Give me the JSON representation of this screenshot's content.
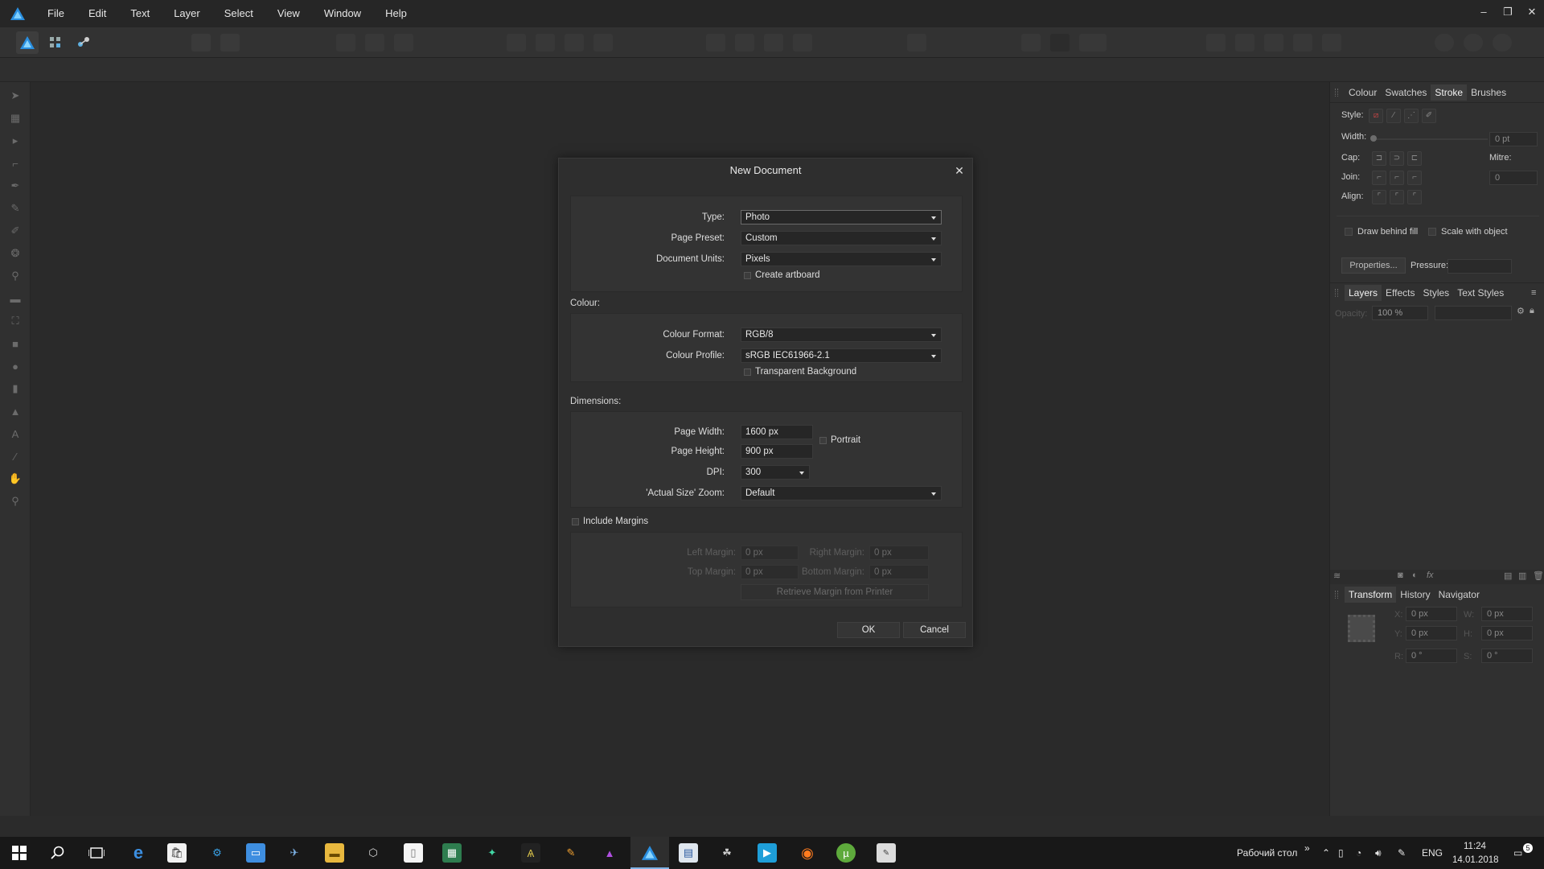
{
  "menu": {
    "items": [
      "File",
      "Edit",
      "Text",
      "Layer",
      "Select",
      "View",
      "Window",
      "Help"
    ]
  },
  "window_controls": {
    "minimize": "–",
    "restore": "❐",
    "close": "✕"
  },
  "right_panel": {
    "top_tabs": [
      "Colour",
      "Swatches",
      "Stroke",
      "Brushes"
    ],
    "top_active": "Stroke",
    "stroke": {
      "style_label": "Style:",
      "width_label": "Width:",
      "width_value": "0 pt",
      "cap_label": "Cap:",
      "mitre_label": "Mitre:",
      "mitre_value": "0",
      "join_label": "Join:",
      "align_label": "Align:",
      "draw_behind_fill": "Draw behind fill",
      "scale_with_object": "Scale with object",
      "properties_button": "Properties...",
      "pressure_label": "Pressure:"
    },
    "layer_tabs": [
      "Layers",
      "Effects",
      "Styles",
      "Text Styles"
    ],
    "layer_active": "Layers",
    "layers": {
      "opacity_label": "Opacity:",
      "opacity_value": "100 %"
    },
    "bottom_tabs": [
      "Transform",
      "History",
      "Navigator"
    ],
    "bottom_active": "Transform",
    "transform": {
      "x_label": "X:",
      "x_value": "0 px",
      "y_label": "Y:",
      "y_value": "0 px",
      "w_label": "W:",
      "w_value": "0 px",
      "h_label": "H:",
      "h_value": "0 px",
      "r_label": "R:",
      "r_value": "0 °",
      "s_label": "S:",
      "s_value": "0 °"
    }
  },
  "dialog": {
    "title": "New Document",
    "close": "✕",
    "type_label": "Type:",
    "type_value": "Photo",
    "preset_label": "Page Preset:",
    "preset_value": "Custom",
    "units_label": "Document Units:",
    "units_value": "Pixels",
    "create_artboard": "Create artboard",
    "colour_section": "Colour:",
    "colour_format_label": "Colour Format:",
    "colour_format_value": "RGB/8",
    "colour_profile_label": "Colour Profile:",
    "colour_profile_value": "sRGB IEC61966-2.1",
    "transparent_bg": "Transparent Background",
    "dimensions_section": "Dimensions:",
    "page_width_label": "Page Width:",
    "page_width_value": "1600 px",
    "page_height_label": "Page Height:",
    "page_height_value": "900 px",
    "portrait": "Portrait",
    "dpi_label": "DPI:",
    "dpi_value": "300",
    "zoom_label": "'Actual Size' Zoom:",
    "zoom_value": "Default",
    "include_margins": "Include Margins",
    "left_margin_label": "Left Margin:",
    "left_margin_value": "0 px",
    "right_margin_label": "Right Margin:",
    "right_margin_value": "0 px",
    "top_margin_label": "Top Margin:",
    "top_margin_value": "0 px",
    "bottom_margin_label": "Bottom Margin:",
    "bottom_margin_value": "0 px",
    "retrieve_margin": "Retrieve Margin from Printer",
    "ok": "OK",
    "cancel": "Cancel"
  },
  "taskbar": {
    "desktop_label": "Рабочий стол",
    "chevron": "»",
    "language": "ENG",
    "time": "11:24",
    "date": "14.01.2018",
    "notification_count": "5"
  },
  "colors": {
    "accent": "#1f8fe0",
    "background": "#2b2b2b",
    "dialog": "#2e2e2e"
  }
}
